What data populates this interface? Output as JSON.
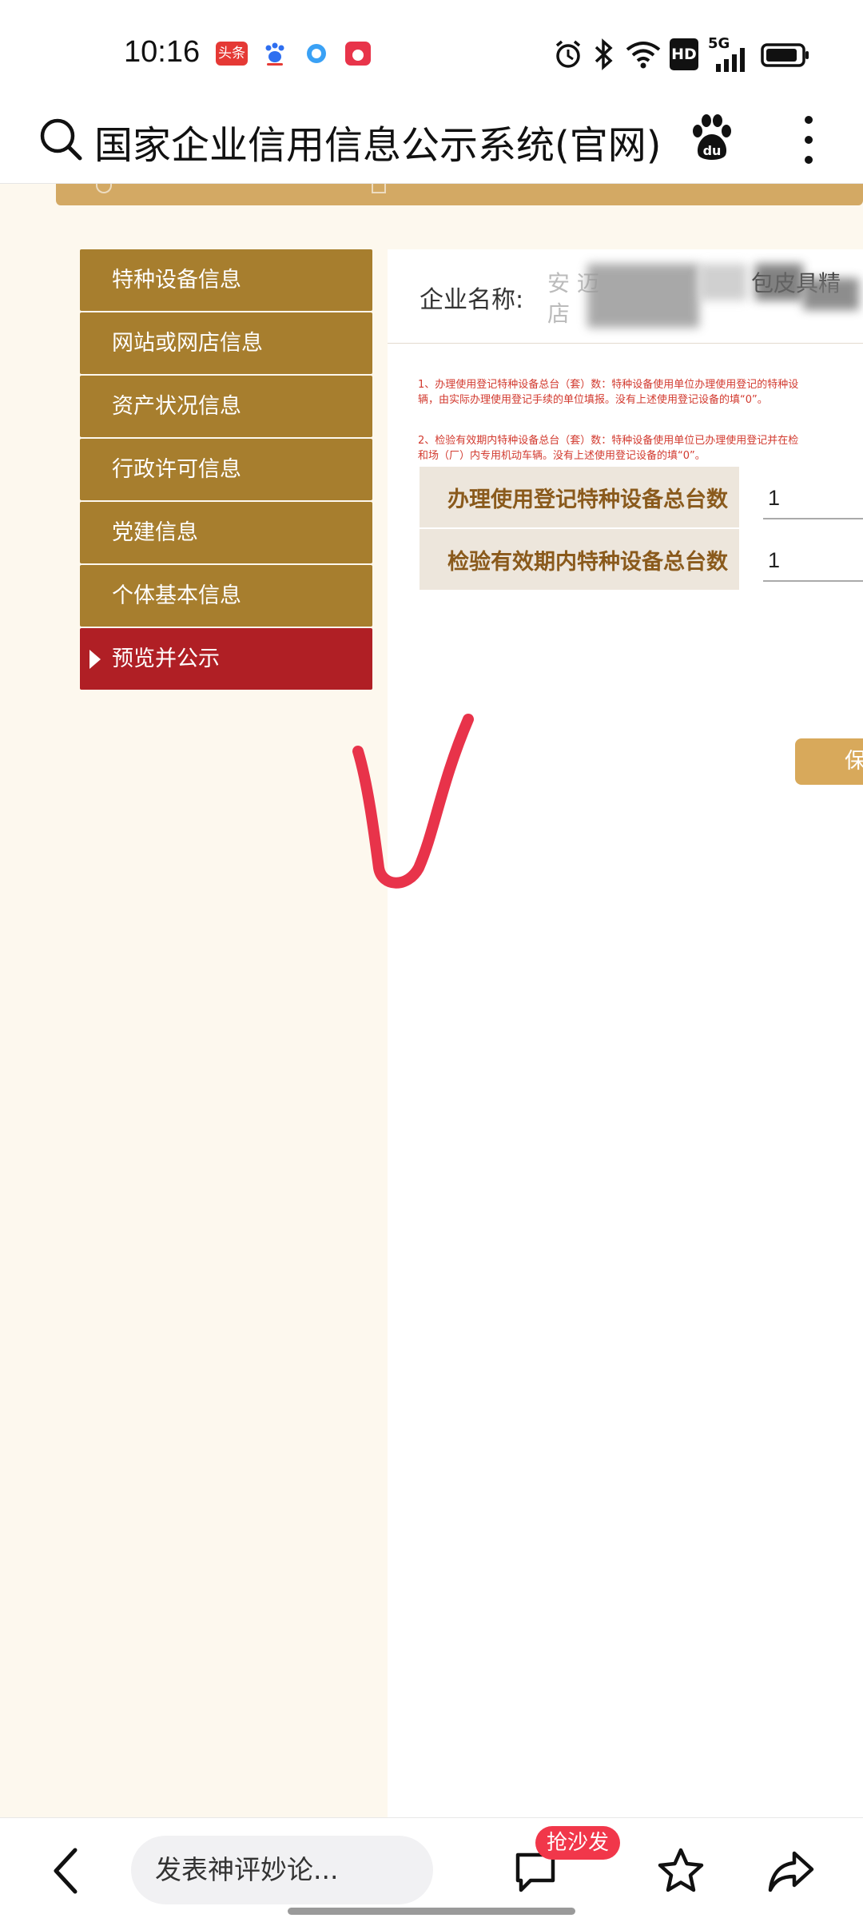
{
  "status_bar": {
    "time": "10:16",
    "notifications": [
      {
        "icon": "toutiao-icon",
        "label": "头条",
        "color": "#e53935"
      },
      {
        "icon": "baidu-paw-icon",
        "color": "#2f6ff0"
      },
      {
        "icon": "quark-icon",
        "color": "#3aa1f5"
      },
      {
        "icon": "video-app-icon",
        "color": "#e8344a"
      }
    ],
    "right_icons": [
      "alarm-icon",
      "bluetooth-icon",
      "wifi-icon",
      "hd-icon",
      "5g-signal-icon",
      "battery-icon"
    ],
    "hd_label": "HD",
    "network_label": "5G"
  },
  "topbar": {
    "title": "国家企业信用信息公示系统(官网)",
    "baidu_label": "du"
  },
  "menu": {
    "items": [
      {
        "label": "特种设备信息",
        "active": false
      },
      {
        "label": "网站或网店信息",
        "active": false
      },
      {
        "label": "资产状况信息",
        "active": false
      },
      {
        "label": "行政许可信息",
        "active": false
      },
      {
        "label": "党建信息",
        "active": false
      },
      {
        "label": "个体基本信息",
        "active": false
      },
      {
        "label": "预览并公示",
        "active": true
      }
    ]
  },
  "content": {
    "company_label": "企业名称:",
    "company_visible_line1_start": "安 迈",
    "company_visible_line1_end": "包皮具精",
    "company_visible_line2": "店",
    "notes": [
      "1、办理使用登记特种设备总台（套）数：特种设备使用单位办理使用登记的特种设",
      "辆，由实际办理使用登记手续的单位填报。没有上述使用登记设备的填“0”。",
      "2、检验有效期内特种设备总台（套）数：特种设备使用单位已办理使用登记并在检",
      "和场（厂）内专用机动车辆。没有上述使用登记设备的填“0”。"
    ],
    "fields": [
      {
        "label": "办理使用登记特种设备总台数",
        "value": "1"
      },
      {
        "label": "检验有效期内特种设备总台数",
        "value": "1"
      }
    ],
    "save_label": "保"
  },
  "colors": {
    "menu_gold": "#a77e2e",
    "menu_active_red": "#b01f25",
    "accent_gold": "#d3a964",
    "note_red": "#d23a2f",
    "label_brown": "#8a5a1c",
    "handmark_red": "#e8334a"
  },
  "bottombar": {
    "comment_placeholder": "发表神评妙论...",
    "badge": "抢沙发"
  }
}
